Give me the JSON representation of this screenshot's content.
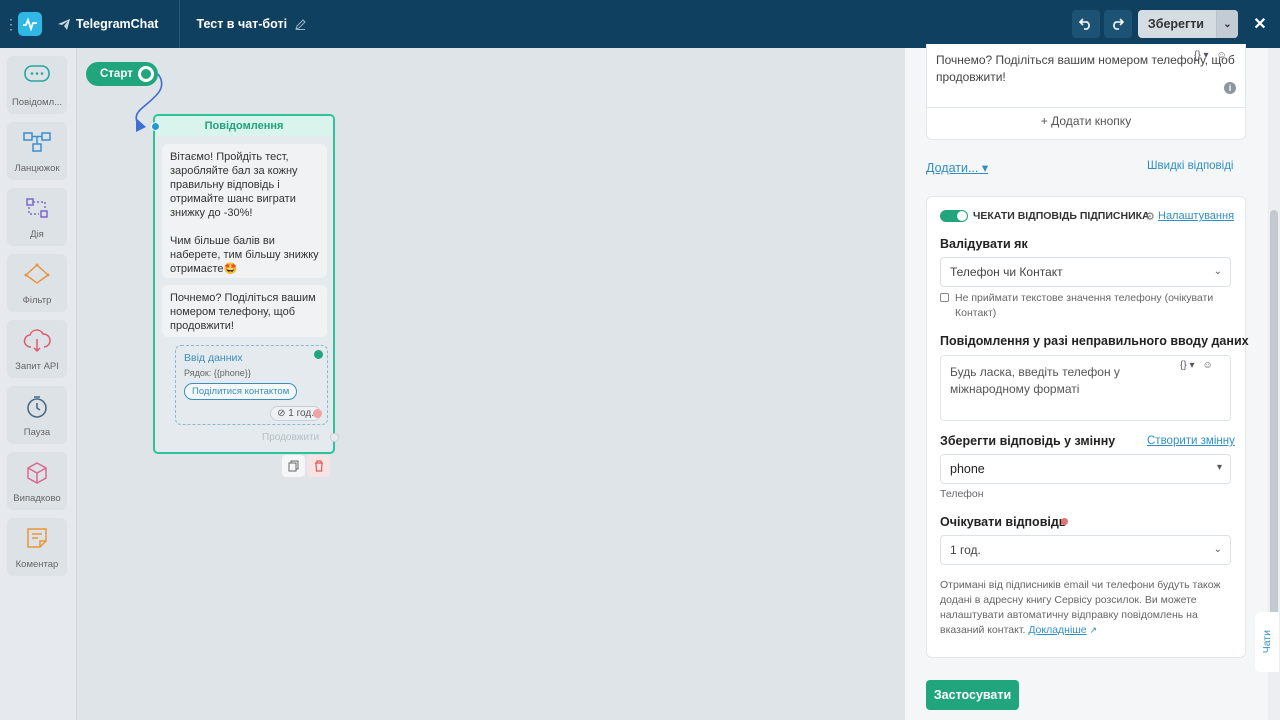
{
  "header": {
    "app_name": "TelegramChat",
    "flow_title": "Тест в чат-боті",
    "save_label": "Зберегти"
  },
  "sidebar": {
    "items": [
      {
        "label": "Повідомл...",
        "icon": "message-icon"
      },
      {
        "label": "Ланцюжок",
        "icon": "chain-icon"
      },
      {
        "label": "Дія",
        "icon": "action-icon"
      },
      {
        "label": "Фільтр",
        "icon": "filter-icon"
      },
      {
        "label": "Запит API",
        "icon": "api-icon"
      },
      {
        "label": "Пауза",
        "icon": "pause-icon"
      },
      {
        "label": "Випадково",
        "icon": "random-icon"
      },
      {
        "label": "Коментар",
        "icon": "comment-icon"
      }
    ]
  },
  "canvas": {
    "start_label": "Старт",
    "node": {
      "title": "Повідомлення",
      "message1": "Вітаємо! Пройдіть тест, заробляйте бал за кожну правильну відповідь і отримайте шанс виграти знижку до -30%!\n\nЧим більше балів ви наберете, тим більшу знижку отримаєте🤩",
      "message2": "Почнемо? Поділіться вашим номером телефону, щоб продовжити!",
      "input_title": "Ввід данних",
      "input_row": "Рядок: {{phone}}",
      "input_button": "Поділитися контактом",
      "timer": "1 год.",
      "continue": "Продовжити"
    }
  },
  "panel": {
    "message_text": "Почнемо? Поділіться вашим номером телефону, щоб продовжити!",
    "add_button": "+ Додати кнопку",
    "add_more": "Додати...",
    "quick_replies": "Швидкі відповіді",
    "wait_toggle_label": "ЧЕКАТИ ВІДПОВІДЬ ПІДПИСНИКА",
    "settings_link": "Налаштування",
    "validate_label": "Валідувати як",
    "validate_value": "Телефон чи Контакт",
    "checkbox_label": "Не приймати текстове значення телефону (очікувати Контакт)",
    "invalid_msg_label": "Повідомлення у разі неправильного вводу даних",
    "invalid_msg_value": "Будь ласка, введіть телефон у міжнародному форматі",
    "save_var_label": "Зберегти відповідь у змінну",
    "create_var_link": "Створити змінну",
    "var_value": "phone",
    "var_hint": "Телефон",
    "wait_label": "Очікувати відповідь",
    "wait_value": "1 год.",
    "info_text": "Отримані від підписників email чи телефони будуть також додані в адресну книгу Сервісу розсилок. Ви можете налаштувати автоматичну відправку повідомлень на вказаний контакт.",
    "more_link": "Докладніше",
    "apply_button": "Застосувати",
    "chats_tab": "Чати"
  },
  "colors": {
    "topbar": "#0f4060",
    "accent_green": "#21a57c",
    "link_blue": "#2f8fc4",
    "required_dot": "#e57373"
  }
}
